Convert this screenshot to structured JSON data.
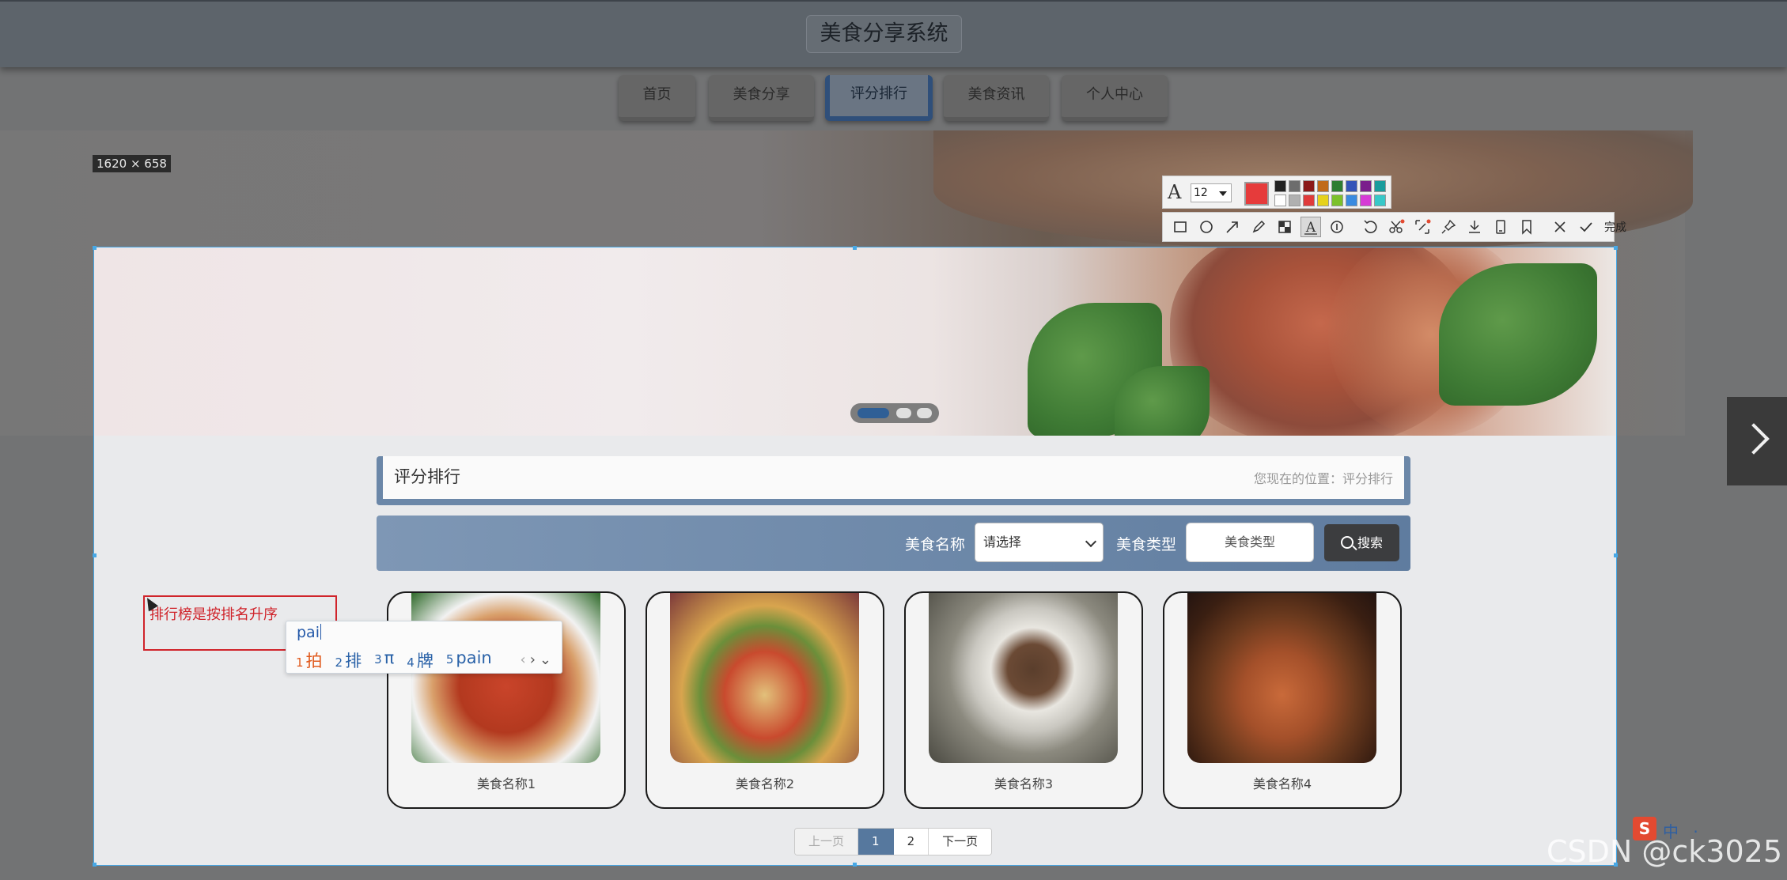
{
  "app": {
    "title": "美食分享系统"
  },
  "nav": {
    "items": [
      {
        "label": "首页",
        "active": false
      },
      {
        "label": "美食分享",
        "active": false
      },
      {
        "label": "评分排行",
        "active": true
      },
      {
        "label": "美食资讯",
        "active": false
      },
      {
        "label": "个人中心",
        "active": false
      }
    ]
  },
  "screenshot_tool": {
    "size_readout": "1620 × 658",
    "font_size": "12",
    "current_color": "#e63b3b",
    "palette": [
      "#222222",
      "#6d6d6d",
      "#8b1a1a",
      "#c06a1a",
      "#2e7d32",
      "#3454b8",
      "#7a1f8c",
      "#1a9c9c",
      "#ffffff",
      "#b0b0b0",
      "#e03b3b",
      "#e6d21b",
      "#7cc12b",
      "#3a8be0",
      "#d63bd6",
      "#38c8c8"
    ],
    "tools": [
      "rectangle-icon",
      "ellipse-icon",
      "arrow-icon",
      "pen-icon",
      "mosaic-icon",
      "text-icon",
      "serial-number-icon",
      "undo-icon",
      "crop-icon",
      "long-screenshot-icon",
      "pin-icon",
      "download-icon",
      "save-icon",
      "bookmark-icon",
      "close-icon"
    ],
    "done_label": "完成"
  },
  "carousel": {
    "dots": 3,
    "active": 0
  },
  "page": {
    "title": "评分排行",
    "breadcrumb": "您现在的位置：评分排行"
  },
  "search": {
    "name_label": "美食名称",
    "name_select_value": "请选择",
    "type_label": "美食类型",
    "type_placeholder": "美食类型",
    "button_label": "搜索"
  },
  "annotation": {
    "text": "排行榜是按排名升序"
  },
  "ime": {
    "input": "pai",
    "candidates": [
      {
        "num": "1",
        "text": "拍"
      },
      {
        "num": "2",
        "text": "排"
      },
      {
        "num": "3",
        "text": "π"
      },
      {
        "num": "4",
        "text": "牌"
      },
      {
        "num": "5",
        "text": "pain"
      }
    ]
  },
  "foods": [
    {
      "name": "美食名称1"
    },
    {
      "name": "美食名称2"
    },
    {
      "name": "美食名称3"
    },
    {
      "name": "美食名称4"
    }
  ],
  "pagination": {
    "prev": "上一页",
    "pages": [
      "1",
      "2"
    ],
    "current": "1",
    "next": "下一页"
  },
  "watermark": "CSDN @ck3025",
  "tray": {
    "text": "中 ·"
  }
}
